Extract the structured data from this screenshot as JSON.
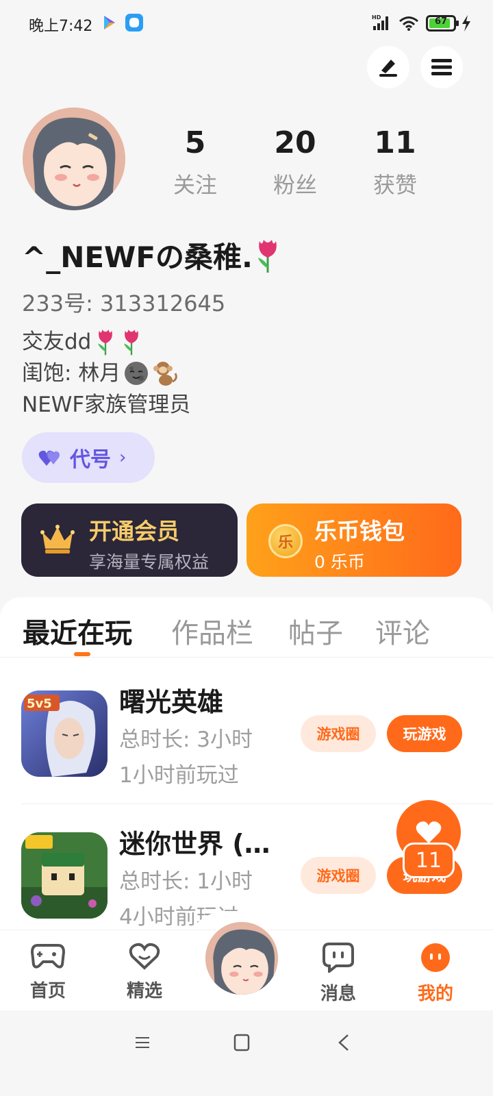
{
  "status_bar": {
    "time": "晚上7:42",
    "battery_level": "67"
  },
  "profile": {
    "stats": [
      {
        "value": "5",
        "label": "关注"
      },
      {
        "value": "20",
        "label": "粉丝"
      },
      {
        "value": "11",
        "label": "获赞"
      }
    ],
    "nickname": "^_NEWFの桑稚.",
    "uid": "233号: 313312645",
    "bio_lines": [
      "交友dd",
      "闺饱: 林月",
      "NEWF家族管理员"
    ],
    "codename_label": "代号"
  },
  "cards": {
    "vip": {
      "title": "开通会员",
      "subtitle": "享海量专属权益"
    },
    "wallet": {
      "title": "乐币钱包",
      "subtitle": "0 乐币",
      "coin_char": "乐"
    }
  },
  "tabs": [
    {
      "label": "最近在玩",
      "active": true
    },
    {
      "label": "作品栏",
      "active": false
    },
    {
      "label": "帖子",
      "active": false
    },
    {
      "label": "评论",
      "active": false
    }
  ],
  "games": [
    {
      "name": "曙光英雄",
      "duration": "总时长: 3小时",
      "last_played": "1小时前玩过",
      "circle_btn": "游戏圈",
      "play_btn": "玩游戏"
    },
    {
      "name": "迷你世界 (…",
      "duration": "总时长: 1小时",
      "last_played": "4小时前玩过",
      "circle_btn": "游戏圈",
      "play_btn": "玩游戏"
    }
  ],
  "fab": {
    "count": "11"
  },
  "bottom_nav": [
    {
      "label": "首页",
      "icon": "gamepad-icon",
      "active": false
    },
    {
      "label": "精选",
      "icon": "heart-outline-icon",
      "active": false
    },
    {
      "label": "消息",
      "icon": "chat-bubble-icon",
      "active": false
    },
    {
      "label": "我的",
      "icon": "smiley-icon",
      "active": true
    }
  ],
  "colors": {
    "accent": "#ff6a1a",
    "purple": "#6356e0",
    "vip_dark": "#2b2738",
    "gold": "#f7cc6a"
  }
}
